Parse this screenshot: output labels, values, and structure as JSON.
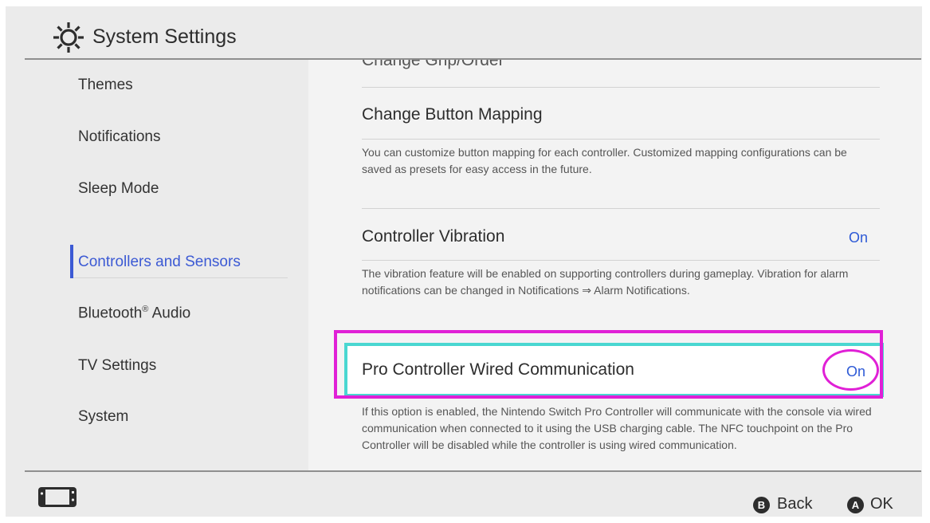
{
  "header": {
    "title": "System Settings",
    "icon": "gear-icon"
  },
  "sidebar": {
    "items": [
      {
        "label": "Themes"
      },
      {
        "label": "Notifications"
      },
      {
        "label": "Sleep Mode"
      },
      {
        "label": "Controllers and Sensors",
        "active": true
      },
      {
        "label": "Bluetooth",
        "sup": "®",
        "suffix": " Audio"
      },
      {
        "label": "TV Settings"
      },
      {
        "label": "System"
      }
    ]
  },
  "content": {
    "partial_title": "Change Grip/Order",
    "rows": [
      {
        "title": "Change Button Mapping",
        "value": "",
        "desc": "You can customize button mapping for each controller. Customized mapping configurations can be saved as presets for easy access in the future."
      },
      {
        "title": "Controller Vibration",
        "value": "On",
        "desc": "The vibration feature will be enabled on supporting controllers during gameplay. Vibration for alarm notifications can be changed in Notifications ⇒ Alarm Notifications."
      },
      {
        "title": "Pro Controller Wired Communication",
        "value": "On",
        "selected": true,
        "desc": "If this option is enabled, the Nintendo Switch Pro Controller will communicate with the console via wired communication when connected to it using the USB charging cable. The NFC touchpoint on the Pro Controller will be disabled while the controller is using wired communication."
      }
    ]
  },
  "footer": {
    "back": {
      "button": "B",
      "label": "Back"
    },
    "ok": {
      "button": "A",
      "label": "OK"
    }
  },
  "colors": {
    "accent": "#3c5ad4",
    "value": "#2e5ad6",
    "selection": "#4ad7d1",
    "annotation": "#e020d6"
  }
}
